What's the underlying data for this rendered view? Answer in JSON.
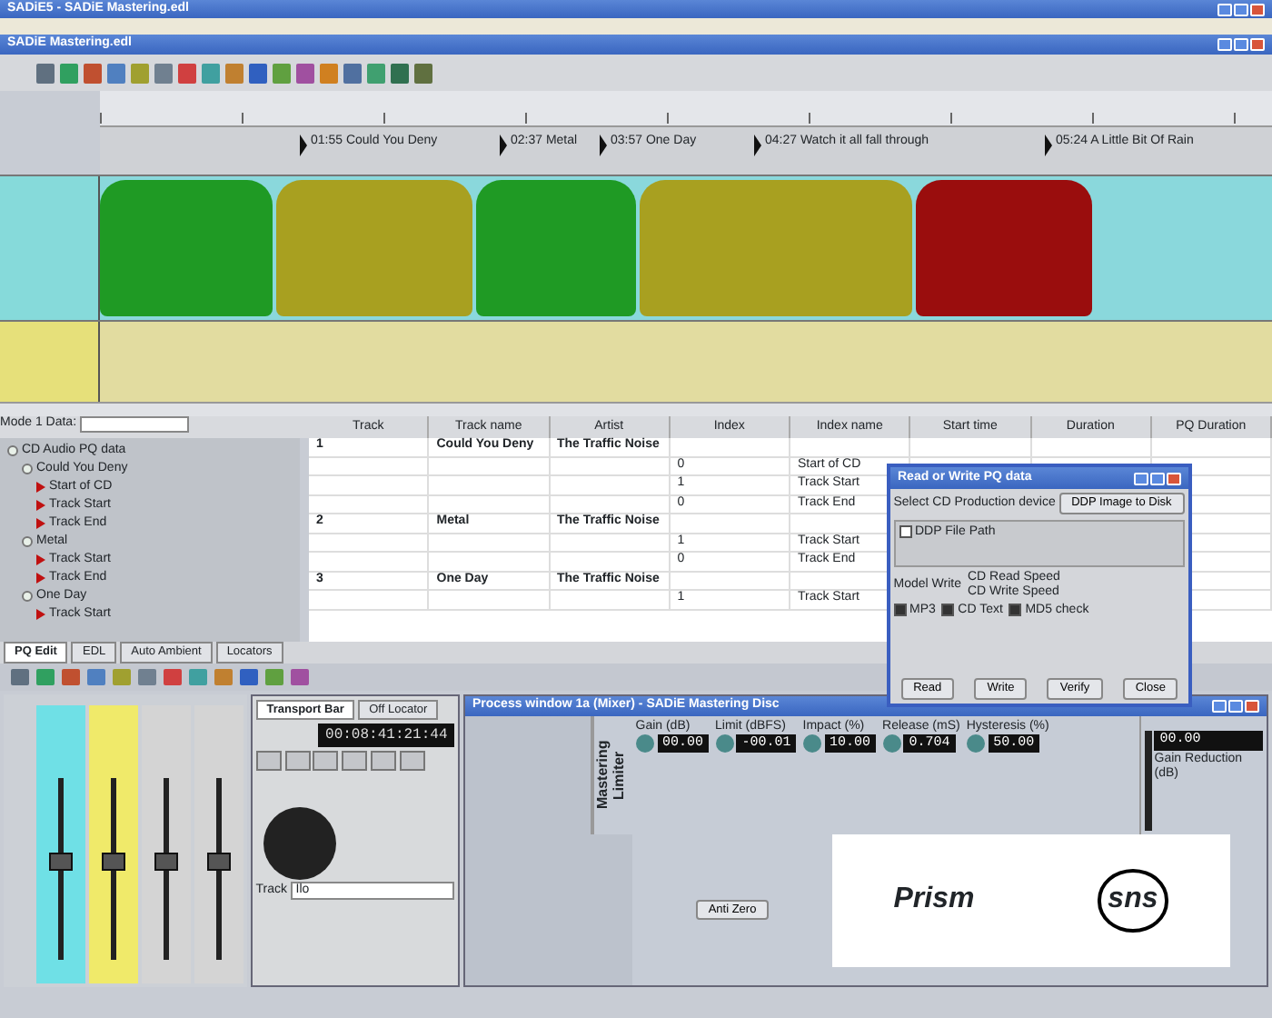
{
  "app_title": "SADiE5 - SADiE Mastering.edl",
  "edl_window": {
    "title": "SADiE Mastering.edl"
  },
  "timeline": {
    "markers": [
      {
        "label": "01:55 Could You Deny"
      },
      {
        "label": "02:37 Metal"
      },
      {
        "label": "03:57 One Day"
      },
      {
        "label": "04:27 Watch it all fall through"
      },
      {
        "label": "05:24 A Little Bit Of Rain"
      }
    ]
  },
  "tracks": [
    {
      "color": "#86dada",
      "clips": [
        {
          "color": "#1f9a24"
        },
        {
          "color": "#a8a020"
        },
        {
          "color": "#1f9a24"
        },
        {
          "color": "#a8a020"
        },
        {
          "color": "#9a0d0d"
        }
      ]
    },
    {
      "color": "#e6e07a"
    }
  ],
  "pq_editor": {
    "mode_label": "Mode 1 Data:",
    "tree": [
      {
        "label": "CD Audio PQ data",
        "children": [
          {
            "label": "Could You Deny",
            "children": [
              {
                "label": "Start of CD"
              },
              {
                "label": "Track Start"
              },
              {
                "label": "Track End"
              }
            ]
          },
          {
            "label": "Metal",
            "children": [
              {
                "label": "Track Start"
              },
              {
                "label": "Track End"
              }
            ]
          },
          {
            "label": "One Day",
            "children": [
              {
                "label": "Track Start"
              }
            ]
          }
        ]
      }
    ],
    "columns": [
      "Track",
      "Track name",
      "Artist",
      "Index",
      "Index name",
      "Start time",
      "Duration",
      "PQ Duration"
    ],
    "rows": [
      {
        "track": "1",
        "track_name": "Could You Deny",
        "artist": "The Traffic Noise"
      },
      {
        "index": "0",
        "index_name": "Start of CD"
      },
      {
        "index": "1",
        "index_name": "Track Start"
      },
      {
        "index": "0",
        "index_name": "Track End"
      },
      {
        "track": "2",
        "track_name": "Metal",
        "artist": "The Traffic Noise"
      },
      {
        "index": "1",
        "index_name": "Track Start"
      },
      {
        "index": "0",
        "index_name": "Track End"
      },
      {
        "track": "3",
        "track_name": "One Day",
        "artist": "The Traffic Noise"
      },
      {
        "index": "1",
        "index_name": "Track Start"
      }
    ],
    "tabs": [
      {
        "label": "PQ Edit",
        "selected": true
      },
      {
        "label": "EDL",
        "selected": false
      },
      {
        "label": "Auto Ambient",
        "selected": false
      },
      {
        "label": "Locators",
        "selected": false
      }
    ]
  },
  "dialog": {
    "title": "Read or Write PQ data",
    "device_label": "Select CD Production device",
    "device_value": "DDP Image to Disk",
    "file_label": "DDP File Path",
    "write_mode_label": "Model Write",
    "speeds": [
      "CD Read Speed",
      "CD Write Speed"
    ],
    "checkboxes": [
      {
        "label": "MP3",
        "checked": true
      },
      {
        "label": "CD Text",
        "checked": true
      },
      {
        "label": "MD5 check",
        "checked": true
      }
    ],
    "buttons": [
      "Read",
      "Write",
      "Verify",
      "Close"
    ]
  },
  "mixer": {
    "channels": [
      {
        "color": "#6fe0e6",
        "level": 0.55
      },
      {
        "color": "#f0ea6a",
        "level": 0.55
      },
      {
        "color": "#d4d4d4",
        "level": 0.55
      },
      {
        "color": "#d4d4d4",
        "level": 0.55
      }
    ]
  },
  "transport": {
    "tabs": [
      {
        "label": "Transport Bar",
        "selected": true
      },
      {
        "label": "Off Locator",
        "selected": false
      }
    ],
    "time": "00:08:41:21:44",
    "track_label": "Track",
    "track_value": "Ilo"
  },
  "plugin": {
    "title": "Process window 1a (Mixer) - SADiE Mastering Disc",
    "name": "Mastering Limiter",
    "params": [
      {
        "label": "Gain (dB)",
        "value": "00.00"
      },
      {
        "label": "Limit (dBFS)",
        "value": "-00.01"
      },
      {
        "label": "Impact (%)",
        "value": "10.00"
      },
      {
        "label": "Release (mS)",
        "value": "0.704"
      },
      {
        "label": "Hysteresis (%)",
        "value": "50.00"
      }
    ],
    "meter_label": "Gain Reduction (dB)",
    "meter_value": "00.00",
    "button": "Anti Zero",
    "logos": [
      "Prism",
      "sns"
    ]
  }
}
